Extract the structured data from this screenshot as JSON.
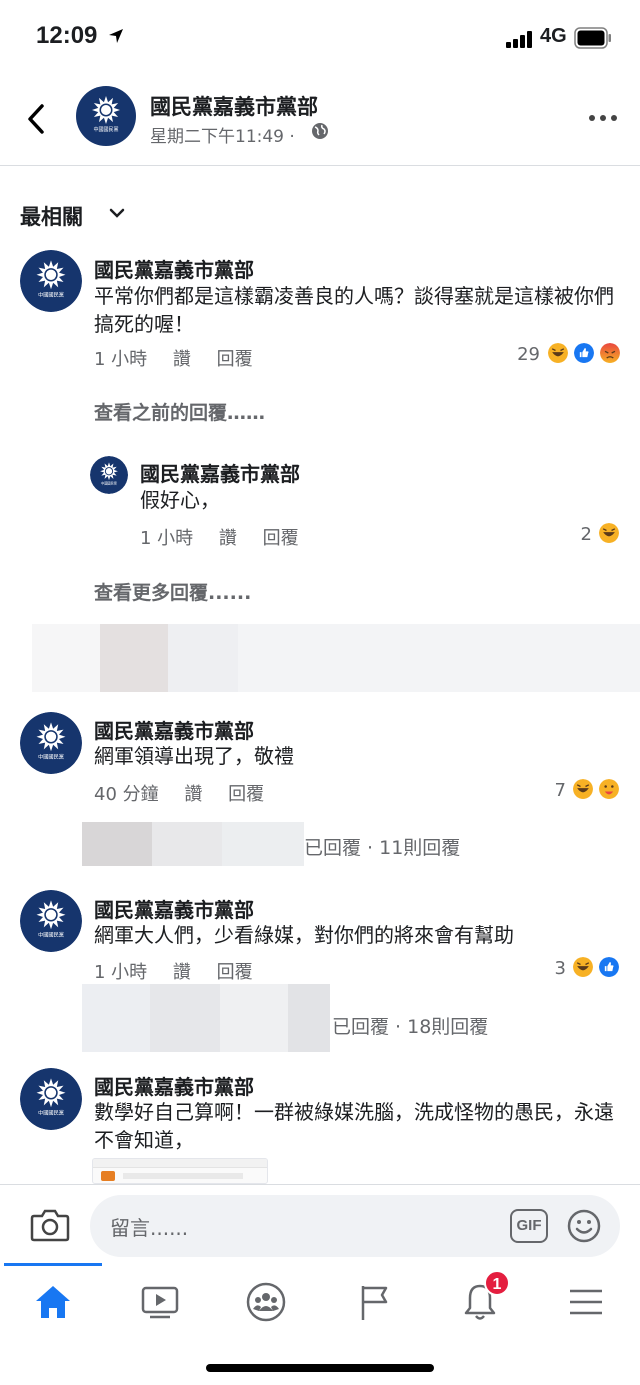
{
  "status_bar": {
    "time": "12:09",
    "network": "4G"
  },
  "header": {
    "title": "國民黨嘉義市黨部",
    "subtitle": "星期二下午11:49 ·"
  },
  "sort": {
    "label": "最相關"
  },
  "comments": [
    {
      "name": "國民黨嘉義市黨部",
      "text": "平常你們都是這樣霸凌善良的人嗎？談得塞就是這樣被你們搞死的喔！",
      "time": "1 小時",
      "like": "讚",
      "reply": "回覆",
      "reactions": "29"
    },
    {
      "name": "國民黨嘉義市黨部",
      "text": "網軍領導出現了，敬禮",
      "time": "40 分鐘",
      "like": "讚",
      "reply": "回覆",
      "reactions": "7"
    },
    {
      "name": "國民黨嘉義市黨部",
      "text": "網軍大人們，少看綠媒，對你們的將來會有幫助",
      "time": "1 小時",
      "like": "讚",
      "reply": "回覆",
      "reactions": "3"
    },
    {
      "name": "國民黨嘉義市黨部",
      "text": "數學好自己算啊！一群被綠媒洗腦，洗成怪物的愚民，永遠不會知道，",
      "time": "",
      "like": "",
      "reply": "",
      "reactions": ""
    }
  ],
  "view_previous": "查看之前的回覆……",
  "nested_reply": {
    "name": "國民黨嘉義市黨部",
    "text": "假好心，",
    "time": "1 小時",
    "like": "讚",
    "reply": "回覆",
    "reactions": "2"
  },
  "view_more": "查看更多回覆......",
  "replied_1": "已回覆 · 11則回覆",
  "replied_2": "已回覆 · 18則回覆",
  "composer": {
    "placeholder": "留言......",
    "gif": "GIF"
  },
  "tabs": [
    "home",
    "watch",
    "groups",
    "pages",
    "notifications",
    "menu"
  ],
  "notification_badge": "1",
  "logo_text": "中國國民黨",
  "icons": [
    "back-icon",
    "globe-icon",
    "more-icon",
    "chevron-down-icon",
    "camera-icon",
    "gif-icon",
    "emoji-icon",
    "home-icon",
    "watch-icon",
    "groups-icon",
    "flag-icon",
    "bell-icon",
    "menu-icon"
  ],
  "colors": {
    "accent": "#1877f2",
    "avatar_bg": "#16356d",
    "badge": "#e41e3f",
    "text_secondary": "#65676b"
  }
}
